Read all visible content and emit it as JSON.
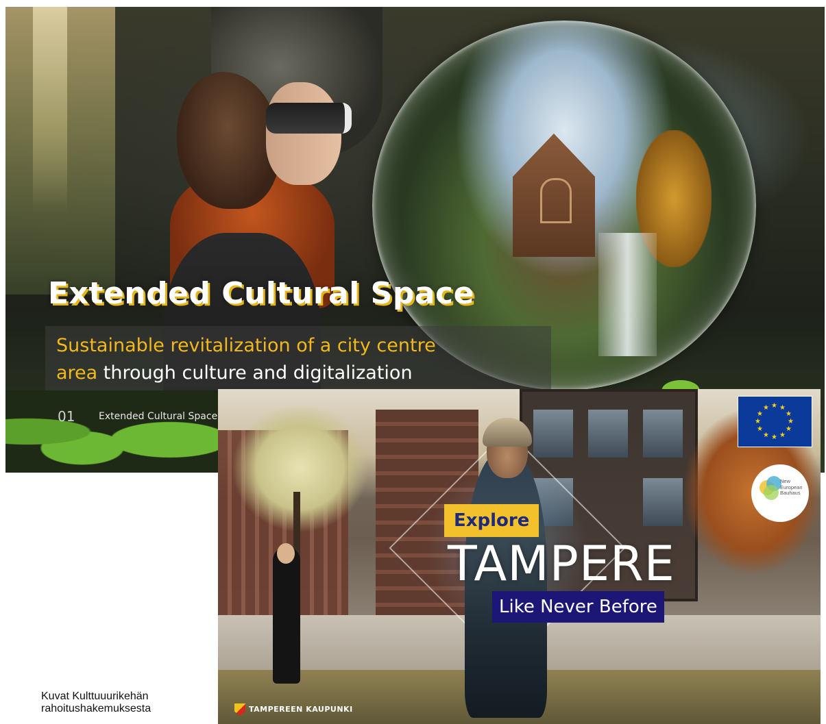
{
  "slide1": {
    "title": "Extended Cultural Space",
    "subtitle_highlight_1": "Sustainable revitalization of a city centre",
    "subtitle_highlight_2": "area",
    "subtitle_rest": " through culture and digitalization",
    "footer_number": "01",
    "footer_text": "Extended Cultural Space",
    "accent_color": "#f2b81c"
  },
  "slide2": {
    "explore": "Explore",
    "city": "TAMPERE",
    "tagline": "Like Never Before",
    "eu_flag_icon": "eu-flag-icon",
    "neb_logo_text": [
      "New",
      "European",
      "Bauhaus"
    ],
    "city_logo_text": "TAMPEREEN KAUPUNKI",
    "explore_bg": "#f3c12c",
    "tagline_bg": "#1c1777"
  },
  "caption": {
    "line1": "Kuvat Kulttuuurikehän",
    "line2": "rahoitushakemuksesta"
  }
}
